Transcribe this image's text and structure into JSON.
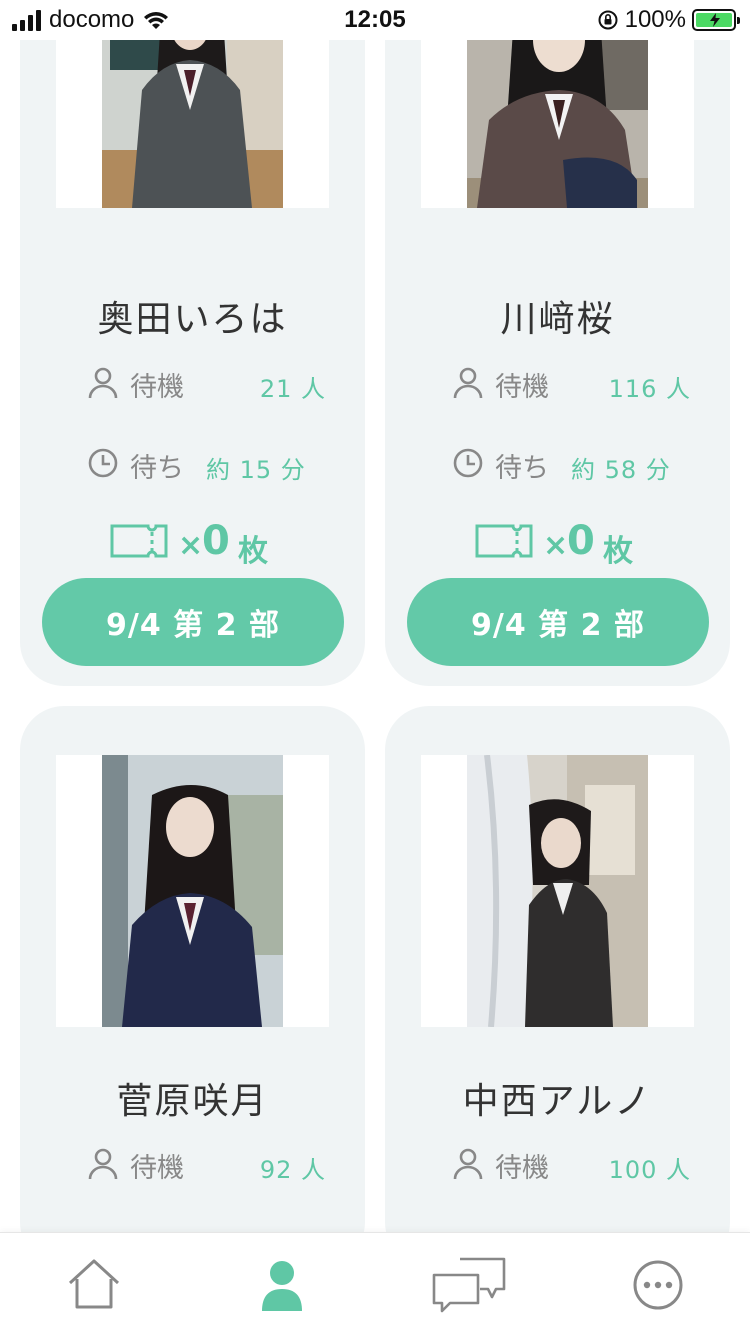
{
  "status_bar": {
    "carrier": "docomo",
    "time": "12:05",
    "battery": "100%"
  },
  "members": [
    {
      "name": "奥田いろは",
      "waiting_label": "待機",
      "waiting_count": "21 人",
      "wait_label": "待ち",
      "wait_time": "約 15 分",
      "ticket_multiplier": "×",
      "ticket_count": "0",
      "ticket_unit": "枚",
      "session_button": "9/4 第 2 部"
    },
    {
      "name": "川﨑桜",
      "waiting_label": "待機",
      "waiting_count": "116 人",
      "wait_label": "待ち",
      "wait_time": "約 58 分",
      "ticket_multiplier": "×",
      "ticket_count": "0",
      "ticket_unit": "枚",
      "session_button": "9/4 第 2 部"
    },
    {
      "name": "菅原咲月",
      "waiting_label": "待機",
      "waiting_count": "92 人"
    },
    {
      "name": "中西アルノ",
      "waiting_label": "待機",
      "waiting_count": "100 人"
    }
  ],
  "tab_bar": {
    "tabs": [
      {
        "icon": "home-icon",
        "active": false
      },
      {
        "icon": "person-icon",
        "active": true
      },
      {
        "icon": "chat-icon",
        "active": false
      },
      {
        "icon": "more-icon",
        "active": false
      }
    ]
  },
  "colors": {
    "accent": "#63c9a8",
    "card_background": "#f0f4f5",
    "label_gray": "#888888"
  }
}
